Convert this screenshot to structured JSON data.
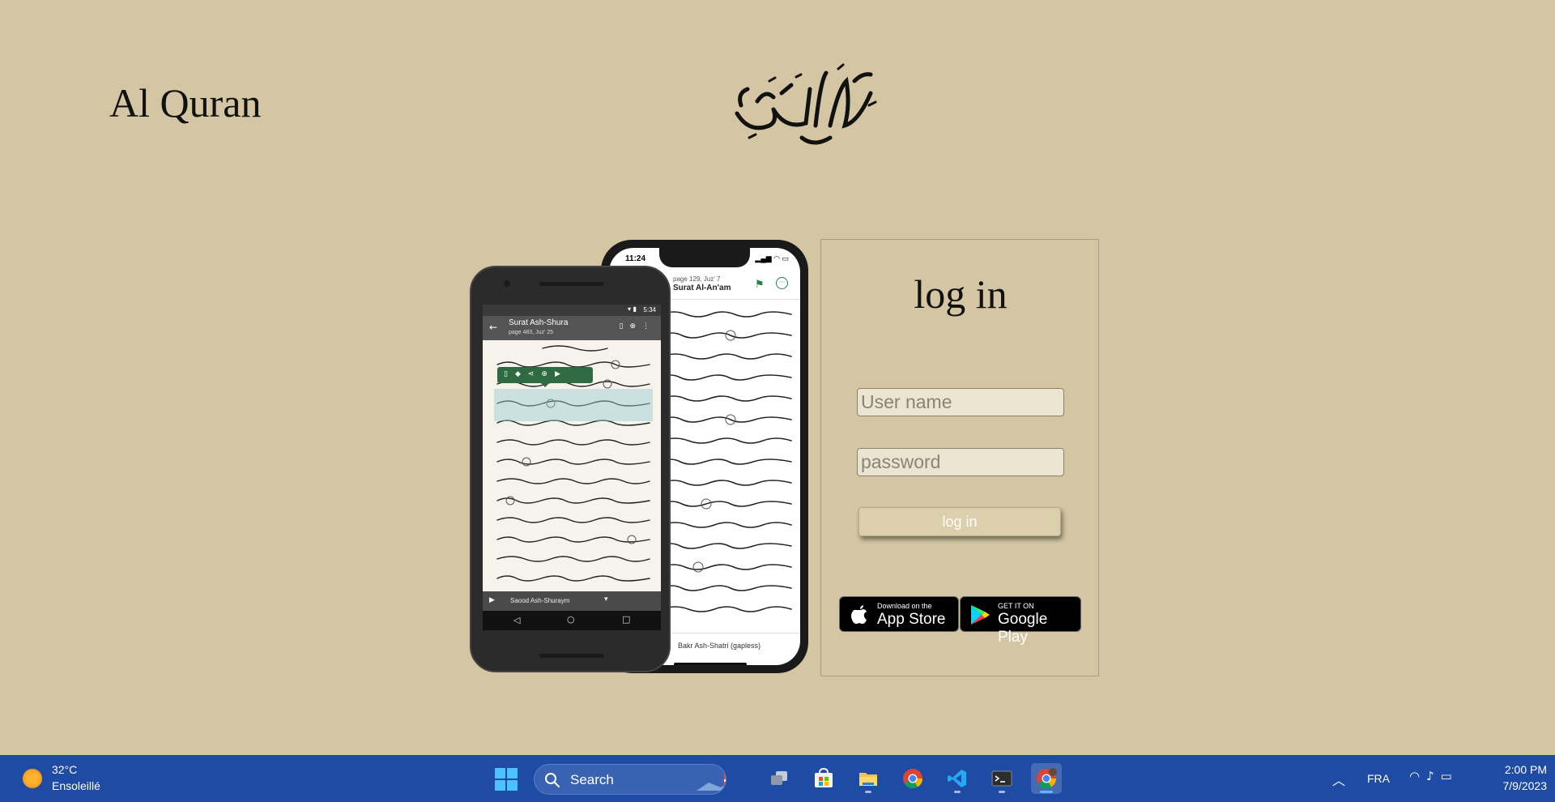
{
  "header": {
    "site_title": "Al Quran",
    "calligraphy_text": "القرآن الكريم"
  },
  "iphone": {
    "time": "11:24",
    "status_icons": "▂▄▆ ◠ ▭",
    "page_info": "page 129, Juz' 7",
    "surah": "Surat Al-An'am",
    "reciter": "Bakr Ash-Shatri (gapless)"
  },
  "android": {
    "time": "5:34",
    "surah": "Surat Ash-Shura",
    "page_info": "page 483, Juz' 25",
    "reciter": "Saood Ash-Shuraym"
  },
  "login": {
    "title": "log in",
    "username_placeholder": "User name",
    "password_placeholder": "password",
    "button_label": "log in"
  },
  "badges": {
    "appstore_small": "Download on the",
    "appstore_big": "App Store",
    "googleplay_small": "GET IT ON",
    "googleplay_big": "Google Play"
  },
  "taskbar": {
    "weather_temp": "32°C",
    "weather_desc": "Ensoleillé",
    "search_label": "Search",
    "language": "FRA",
    "time": "2:00 PM",
    "date": "7/9/2023"
  },
  "colors": {
    "page_background": "#d4c6a2",
    "taskbar": "#1e4ba3",
    "quran_accent": "#2e7d4f"
  }
}
